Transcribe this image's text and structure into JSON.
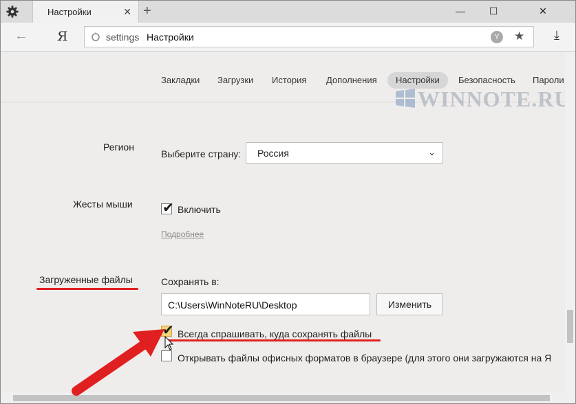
{
  "browser": {
    "tab_title": "Настройки",
    "tab_close": "✕",
    "new_tab": "+",
    "window_controls": {
      "minimize": "—",
      "maximize": "☐",
      "close": "✕"
    },
    "back_glyph": "←",
    "logo": "Я",
    "address": {
      "scheme": "settings",
      "page_title": "Настройки"
    },
    "icons": [
      "gear-icon",
      "back-arrow-icon",
      "lock-icon",
      "protect-icon",
      "star-icon",
      "download-icon"
    ]
  },
  "nav": {
    "items": [
      "Закладки",
      "Загрузки",
      "История",
      "Дополнения",
      "Настройки",
      "Безопасность",
      "Пароли"
    ],
    "active": "Настройки"
  },
  "watermark": "WINNOTE.RU",
  "settings": {
    "region": {
      "label": "Регион",
      "prompt": "Выберите страну:",
      "selected": "Россия"
    },
    "mouse_gestures": {
      "label": "Жесты мыши",
      "checkbox_label": "Включить",
      "checked": true,
      "more_link": "Подробнее"
    },
    "downloads": {
      "label": "Загруженные файлы",
      "save_to_label": "Сохранять в:",
      "path": "C:\\Users\\WinNoteRU\\Desktop",
      "change_button": "Изменить",
      "always_ask_label": "Всегда спрашивать, куда сохранять файлы",
      "always_ask_checked": true,
      "open_office_label": "Открывать файлы офисных форматов в браузере (для этого они загружаются на Я",
      "open_office_checked": false
    }
  },
  "colors": {
    "accent_red": "#e02020",
    "content_bg": "#efedeb"
  }
}
